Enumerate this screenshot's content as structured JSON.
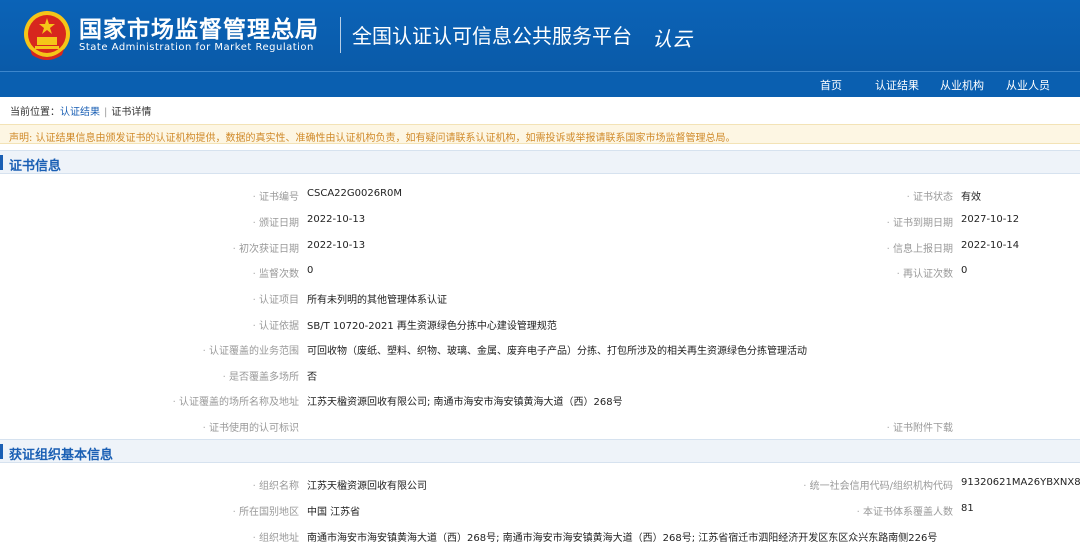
{
  "header": {
    "org_cn": "国家市场监督管理总局",
    "org_en": "State Administration  for  Market Regulation",
    "platform": "全国认证认可信息公共服务平台",
    "brand_mark": "认云"
  },
  "nav": {
    "items": [
      "首页",
      "认证结果",
      "从业机构",
      "从业人员"
    ]
  },
  "breadcrumb": {
    "prefix": "当前位置：",
    "link": "认证结果",
    "separator": "|",
    "current": "证书详情"
  },
  "notice": "声明: 认证结果信息由颁发证书的认证机构提供，数据的真实性、准确性由认证机构负责，如有疑问请联系认证机构，如需投诉或举报请联系国家市场监督管理总局。",
  "cert_section": {
    "title": "证书信息",
    "cert_no_label": "证书编号",
    "cert_no": "CSCA22G0026R0M",
    "status_label": "证书状态",
    "status": "有效",
    "issue_date_label": "颁证日期",
    "issue_date": "2022-10-13",
    "expire_date_label": "证书到期日期",
    "expire_date": "2027-10-12",
    "first_date_label": "初次获证日期",
    "first_date": "2022-10-13",
    "report_date_label": "信息上报日期",
    "report_date": "2022-10-14",
    "surveillance_label": "监督次数",
    "surveillance": "0",
    "recert_label": "再认证次数",
    "recert": "0",
    "project_label": "认证项目",
    "project": "所有未列明的其他管理体系认证",
    "basis_label": "认证依据",
    "basis": "SB/T 10720-2021 再生资源绿色分拣中心建设管理规范",
    "scope_label": "认证覆盖的业务范围",
    "scope": "可回收物（废纸、塑料、织物、玻璃、金属、废弃电子产品）分拣、打包所涉及的相关再生资源绿色分拣管理活动",
    "multisite_label": "是否覆盖多场所",
    "multisite": "否",
    "sites_label": "认证覆盖的场所名称及地址",
    "sites": "江苏天楹资源回收有限公司;  南通市海安市海安镇黄海大道（西）268号",
    "mark_label": "证书使用的认可标识",
    "attachment_label": "证书附件下载"
  },
  "org_section": {
    "title": "获证组织基本信息",
    "name_label": "组织名称",
    "name": "江苏天楹资源回收有限公司",
    "credit_code_label": "统一社会信用代码/组织机构代码",
    "credit_code": "91320621MA26YBXNX8",
    "region_label": "所在国别地区",
    "region": "中国 江苏省",
    "headcount_label": "本证书体系覆盖人数",
    "headcount": "81",
    "address_label": "组织地址",
    "address": "南通市海安市海安镇黄海大道（西）268号;  南通市海安市海安镇黄海大道（西）268号;  江苏省宿迁市泗阳经济开发区东区众兴东路南侧226号"
  },
  "colors": {
    "header_blue": "#0b63b7",
    "link_blue": "#1a5fb4",
    "notice_orange": "#d08a2a",
    "emblem_red": "#d7261e",
    "emblem_gold": "#f5c518"
  }
}
